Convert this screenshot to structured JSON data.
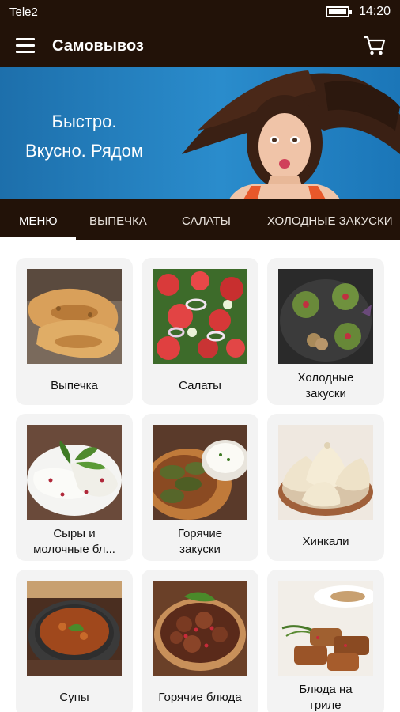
{
  "status_bar": {
    "carrier": "Tele2",
    "time": "14:20"
  },
  "app_bar": {
    "title": "Самовывоз",
    "menu_icon": "hamburger-icon",
    "cart_icon": "cart-icon"
  },
  "banner": {
    "line1": "Быстро.",
    "line2": "Вкусно. Рядом"
  },
  "tabs": [
    {
      "label": "МЕНЮ",
      "active": true
    },
    {
      "label": "ВЫПЕЧКА",
      "active": false
    },
    {
      "label": "САЛАТЫ",
      "active": false
    },
    {
      "label": "ХОЛОДНЫЕ ЗАКУСКИ",
      "active": false
    }
  ],
  "categories": [
    {
      "label": "Выпечка"
    },
    {
      "label": "Салаты"
    },
    {
      "label_line1": "Холодные",
      "label_line2": "закуски"
    },
    {
      "label_line1": "Сыры и",
      "label_line2": "молочные бл..."
    },
    {
      "label_line1": "Горячие",
      "label_line2": "закуски"
    },
    {
      "label": "Хинкали"
    },
    {
      "label": "Супы"
    },
    {
      "label": "Горячие блюда"
    },
    {
      "label_line1": "Блюда на",
      "label_line2": "гриле"
    }
  ],
  "colors": {
    "app_bar": "#221208",
    "banner": "#2a8ccc",
    "card_bg": "#f3f3f3"
  }
}
